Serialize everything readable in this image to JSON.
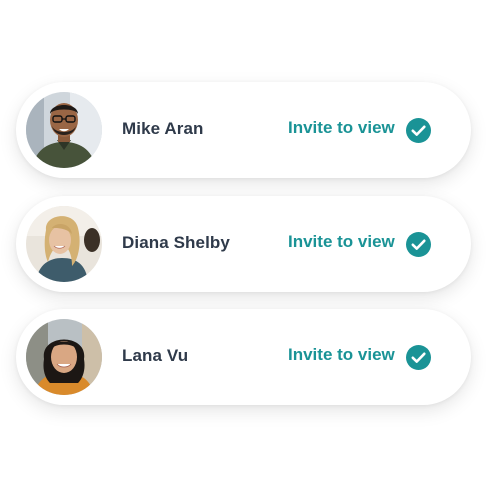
{
  "colors": {
    "accent": "#1a9396",
    "name_text": "#2f3a4a",
    "card_bg": "#ffffff"
  },
  "contacts": [
    {
      "name": "Mike Aran",
      "action_label": "Invite to view",
      "status_icon": "check-circle-icon"
    },
    {
      "name": "Diana Shelby",
      "action_label": "Invite to view",
      "status_icon": "check-circle-icon"
    },
    {
      "name": "Lana Vu",
      "action_label": "Invite to view",
      "status_icon": "check-circle-icon"
    }
  ]
}
